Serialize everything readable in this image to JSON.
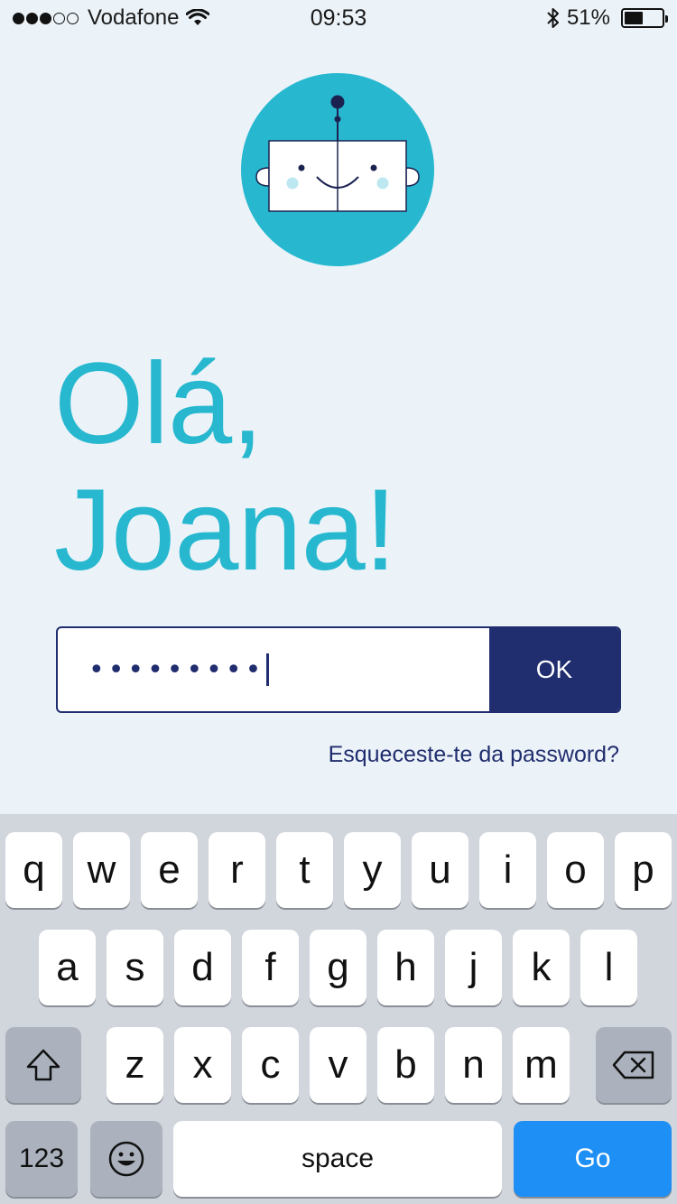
{
  "status_bar": {
    "carrier": "Vodafone",
    "time": "09:53",
    "battery_percent": "51%",
    "battery_level": 0.51,
    "signal_bars_filled": 3,
    "signal_bars_total": 5,
    "icons": [
      "wifi-icon",
      "bluetooth-icon",
      "battery-icon"
    ]
  },
  "greeting": {
    "line1": "Olá,",
    "line2": "Joana!",
    "color": "#27b8d0"
  },
  "login": {
    "password_masked": "•••••••••",
    "ok_label": "OK",
    "forgot_label": "Esqueceste-te da password?",
    "accent": "#202d6e"
  },
  "keyboard": {
    "row1": [
      "q",
      "w",
      "e",
      "r",
      "t",
      "y",
      "u",
      "i",
      "o",
      "p"
    ],
    "row2": [
      "a",
      "s",
      "d",
      "f",
      "g",
      "h",
      "j",
      "k",
      "l"
    ],
    "row3": [
      "z",
      "x",
      "c",
      "v",
      "b",
      "n",
      "m"
    ],
    "numbers_label": "123",
    "space_label": "space",
    "go_label": "Go",
    "go_color": "#1e8ff5"
  }
}
